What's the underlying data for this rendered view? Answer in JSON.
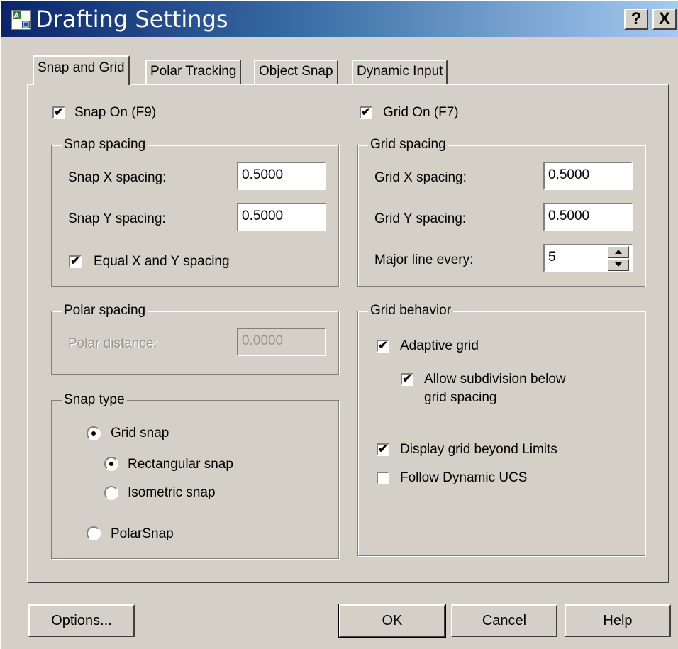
{
  "title": "Drafting Settings",
  "title_buttons": {
    "help": "?",
    "close": "X"
  },
  "tabs": [
    {
      "label": "Snap and Grid"
    },
    {
      "label": "Polar Tracking"
    },
    {
      "label": "Object Snap"
    },
    {
      "label": "Dynamic Input"
    }
  ],
  "snap": {
    "on_label": "Snap On (F9)",
    "on_checked": true,
    "spacing_legend": "Snap spacing",
    "x_label": "Snap X spacing:",
    "x_value": "0.5000",
    "y_label": "Snap Y spacing:",
    "y_value": "0.5000",
    "equal_label": "Equal X and Y spacing",
    "equal_checked": true
  },
  "polar": {
    "legend": "Polar spacing",
    "distance_label": "Polar distance:",
    "distance_value": "0.0000"
  },
  "snap_type": {
    "legend": "Snap type",
    "grid_snap": "Grid snap",
    "rectangular": "Rectangular snap",
    "isometric": "Isometric snap",
    "polarsnap": "PolarSnap"
  },
  "grid": {
    "on_label": "Grid On (F7)",
    "on_checked": true,
    "spacing_legend": "Grid spacing",
    "x_label": "Grid X spacing:",
    "x_value": "0.5000",
    "y_label": "Grid Y spacing:",
    "y_value": "0.5000",
    "major_label": "Major line every:",
    "major_value": "5"
  },
  "behavior": {
    "legend": "Grid behavior",
    "adaptive": "Adaptive grid",
    "subdivision_line1": "Allow subdivision below",
    "subdivision_line2": "grid spacing",
    "beyond_limits": "Display grid beyond Limits",
    "follow_ucs": "Follow Dynamic UCS"
  },
  "buttons": {
    "options": "Options...",
    "ok": "OK",
    "cancel": "Cancel",
    "help": "Help"
  },
  "colors": {
    "face": "#d4d0c8",
    "title_start": "#0a246a",
    "title_end": "#a6caf0"
  }
}
